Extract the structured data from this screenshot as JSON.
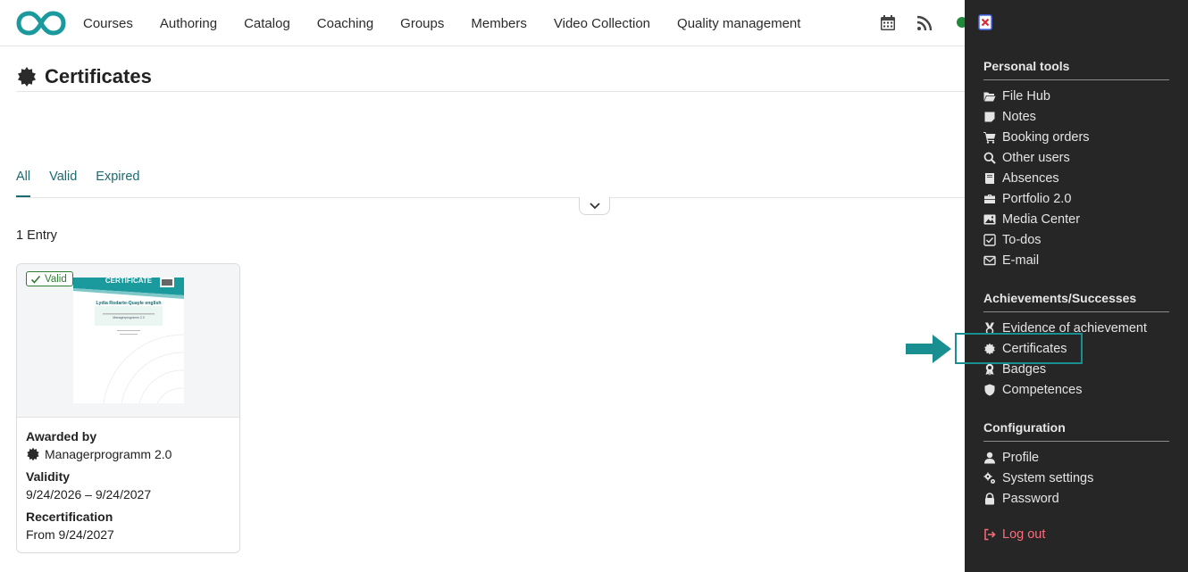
{
  "nav": {
    "links": [
      "Courses",
      "Authoring",
      "Catalog",
      "Coaching",
      "Groups",
      "Members",
      "Video Collection",
      "Quality management"
    ],
    "icons": [
      "calendar-icon",
      "rss-icon"
    ],
    "status_color": "#1f8a3a"
  },
  "page": {
    "title": "Certificates",
    "tabs": [
      "All",
      "Valid",
      "Expired"
    ],
    "active_tab": "All",
    "entry_count": "1 Entry"
  },
  "card": {
    "badge": "Valid",
    "thumbnail": {
      "header": "CERTIFICATE",
      "recipient": "Lydia Rodarte-Quayle english",
      "program": "Managerprogramm 2.0"
    },
    "awarded_by_label": "Awarded by",
    "awarded_by_value": "Managerprogramm 2.0",
    "validity_label": "Validity",
    "validity_value": "9/24/2026 – 9/24/2027",
    "recert_label": "Recertification",
    "recert_value": "From 9/24/2027"
  },
  "panel": {
    "sections": [
      {
        "title": "Personal tools",
        "items": [
          "File Hub",
          "Notes",
          "Booking orders",
          "Other users",
          "Absences",
          "Portfolio 2.0",
          "Media Center",
          "To-dos",
          "E-mail"
        ]
      },
      {
        "title": "Achievements/Successes",
        "items": [
          "Evidence of achievement",
          "Certificates",
          "Badges",
          "Competences"
        ]
      },
      {
        "title": "Configuration",
        "items": [
          "Profile",
          "System settings",
          "Password"
        ]
      }
    ],
    "logout": "Log out"
  },
  "colors": {
    "accent": "#1a6b70",
    "panel_bg": "#262626",
    "logout": "#ff6b7a",
    "highlight": "#1a8f92",
    "valid": "#2f7d32"
  }
}
